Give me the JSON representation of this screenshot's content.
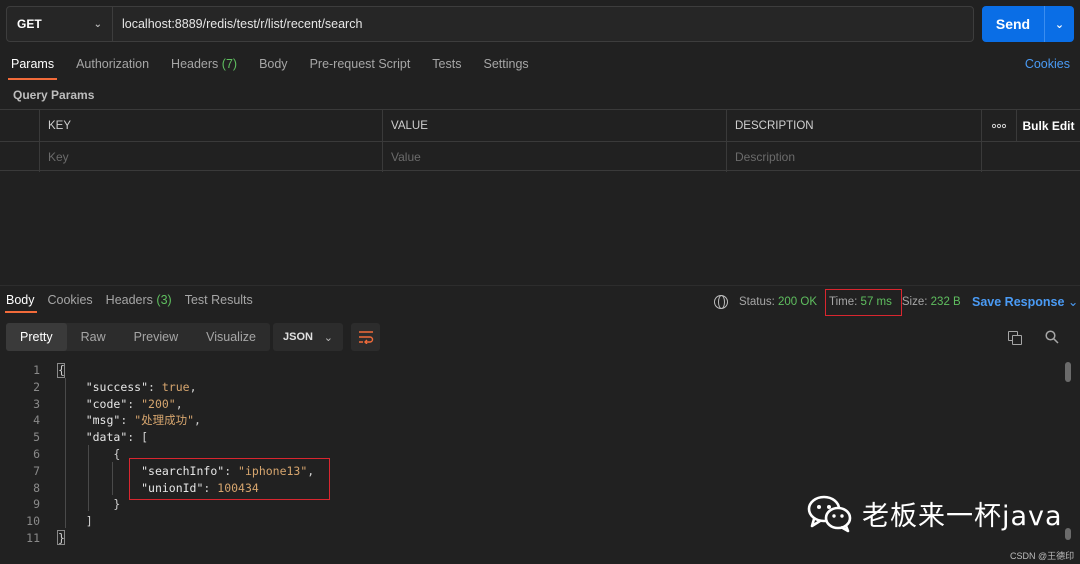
{
  "request": {
    "method": "GET",
    "url": "localhost:8889/redis/test/r/list/recent/search",
    "send_label": "Send"
  },
  "req_tabs": [
    {
      "label": "Params",
      "count": ""
    },
    {
      "label": "Authorization",
      "count": ""
    },
    {
      "label": "Headers",
      "count": "(7)"
    },
    {
      "label": "Body",
      "count": ""
    },
    {
      "label": "Pre-request Script",
      "count": ""
    },
    {
      "label": "Tests",
      "count": ""
    },
    {
      "label": "Settings",
      "count": ""
    }
  ],
  "cookies_label": "Cookies",
  "query_params_title": "Query Params",
  "params_table": {
    "headers": [
      "KEY",
      "VALUE",
      "DESCRIPTION"
    ],
    "bulk_edit": "Bulk Edit",
    "more": "ooo",
    "placeholders": [
      "Key",
      "Value",
      "Description"
    ]
  },
  "resp_tabs": [
    {
      "label": "Body",
      "count": ""
    },
    {
      "label": "Cookies",
      "count": ""
    },
    {
      "label": "Headers",
      "count": "(3)"
    },
    {
      "label": "Test Results",
      "count": ""
    }
  ],
  "stats": {
    "status_label": "Status:",
    "status_value": "200 OK",
    "time_label": "Time:",
    "time_value": "57 ms",
    "size_label": "Size:",
    "size_value": "232 B"
  },
  "save_response": "Save Response",
  "view_modes": [
    "Pretty",
    "Raw",
    "Preview",
    "Visualize"
  ],
  "format": "JSON",
  "code_lines": [
    "1",
    "2",
    "3",
    "4",
    "5",
    "6",
    "7",
    "8",
    "9",
    "10",
    "11"
  ],
  "json": {
    "k_success": "\"success\"",
    "v_success": "true",
    "k_code": "\"code\"",
    "v_code": "\"200\"",
    "k_msg": "\"msg\"",
    "v_msg": "\"处理成功\"",
    "k_data": "\"data\"",
    "k_searchInfo": "\"searchInfo\"",
    "v_searchInfo": "\"iphone13\"",
    "k_unionId": "\"unionId\"",
    "v_unionId": "100434"
  },
  "watermark": {
    "text": "老板来一杯java",
    "sub": "CSDN @王德印"
  },
  "colors": {
    "accent": "#0a6ee6",
    "tab_underline": "#f26b3a",
    "success": "#5fbf5f",
    "highlight_box": "#d9262f",
    "link": "#4a9bf5"
  }
}
